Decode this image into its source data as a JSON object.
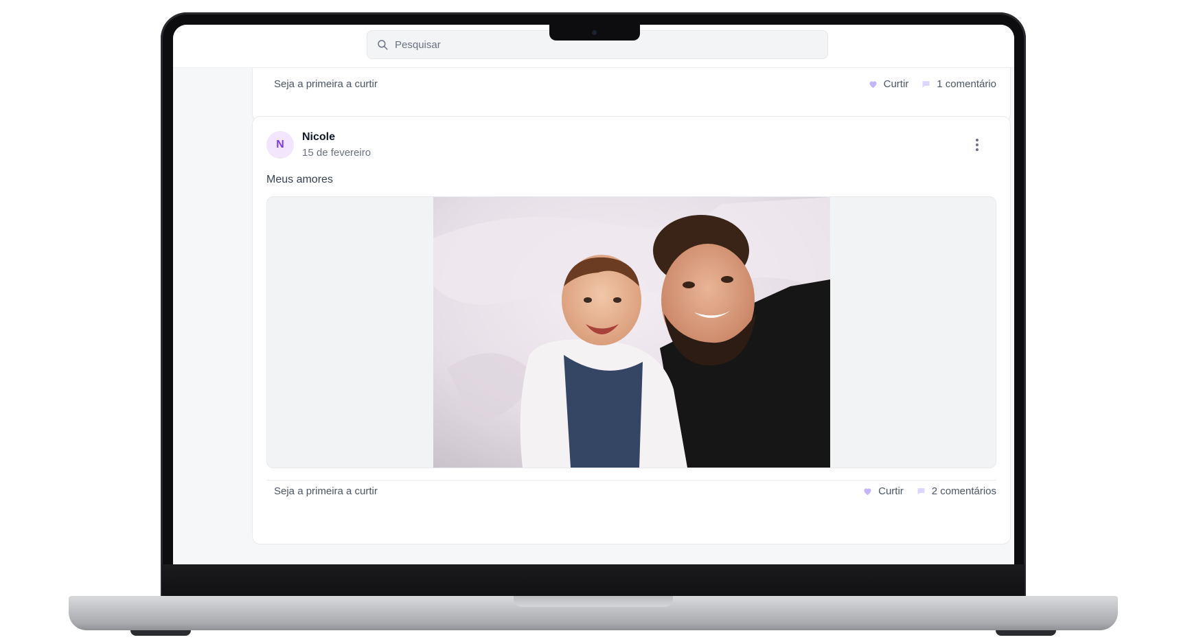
{
  "search": {
    "placeholder": "Pesquisar",
    "value": ""
  },
  "previous_post": {
    "likes_text": "Seja a primeira a curtir",
    "like_label": "Curtir",
    "comments_label": "1 comentário"
  },
  "post": {
    "avatar_initial": "N",
    "author": "Nicole",
    "date": "15 de fevereiro",
    "text": "Meus amores",
    "likes_text": "Seja a primeira a curtir",
    "like_label": "Curtir",
    "comments_label": "2 comentários"
  },
  "colors": {
    "accent": "#7c3aed",
    "avatar_bg": "#f1e6fb",
    "page_bg": "#f6f7f9"
  },
  "icons": {
    "search": "search-icon",
    "like": "heart-icon",
    "comment": "comment-icon",
    "more": "more-vertical-icon"
  }
}
